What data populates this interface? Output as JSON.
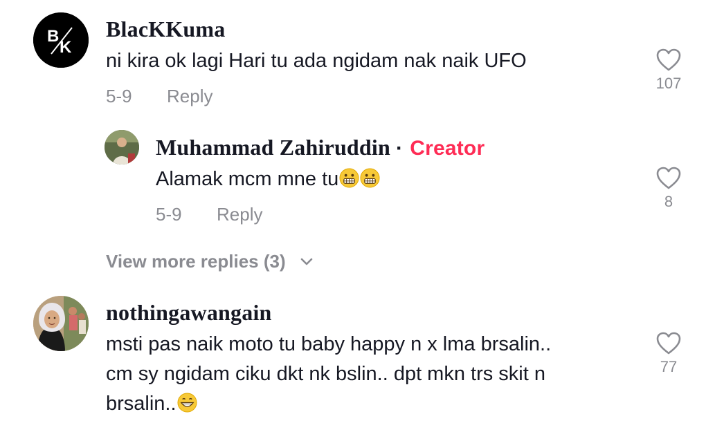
{
  "comments": [
    {
      "username": "BlacKKuma",
      "avatar_monogram": "BK",
      "text": "ni kira ok lagi Hari tu ada ngidam nak naik UFO",
      "date": "5-9",
      "reply_label": "Reply",
      "likes": "107",
      "icon": "heart-outline-icon"
    },
    {
      "username": "Muhammad Zahiruddin",
      "separator": "·",
      "badge": "Creator",
      "text": "Alamak mcm mne tu",
      "text_emoji": "grimacing-face-emoji x2",
      "date": "5-9",
      "reply_label": "Reply",
      "likes": "8",
      "icon": "heart-outline-icon"
    },
    {
      "username": "nothingawangain",
      "text_lines": [
        "msti pas naik moto tu baby happy n x lma brsalin..",
        "cm sy ngidam ciku dkt nk bslin.. dpt mkn trs skit n",
        "brsalin.."
      ],
      "text_emoji": "grinning-face-emoji",
      "likes": "77",
      "icon": "heart-outline-icon"
    }
  ],
  "view_more": {
    "label": "View more replies (3)",
    "icon": "chevron-down-icon"
  },
  "colors": {
    "creator_badge": "#fe2c55",
    "meta_gray": "#8a8b91",
    "text": "#161823"
  }
}
